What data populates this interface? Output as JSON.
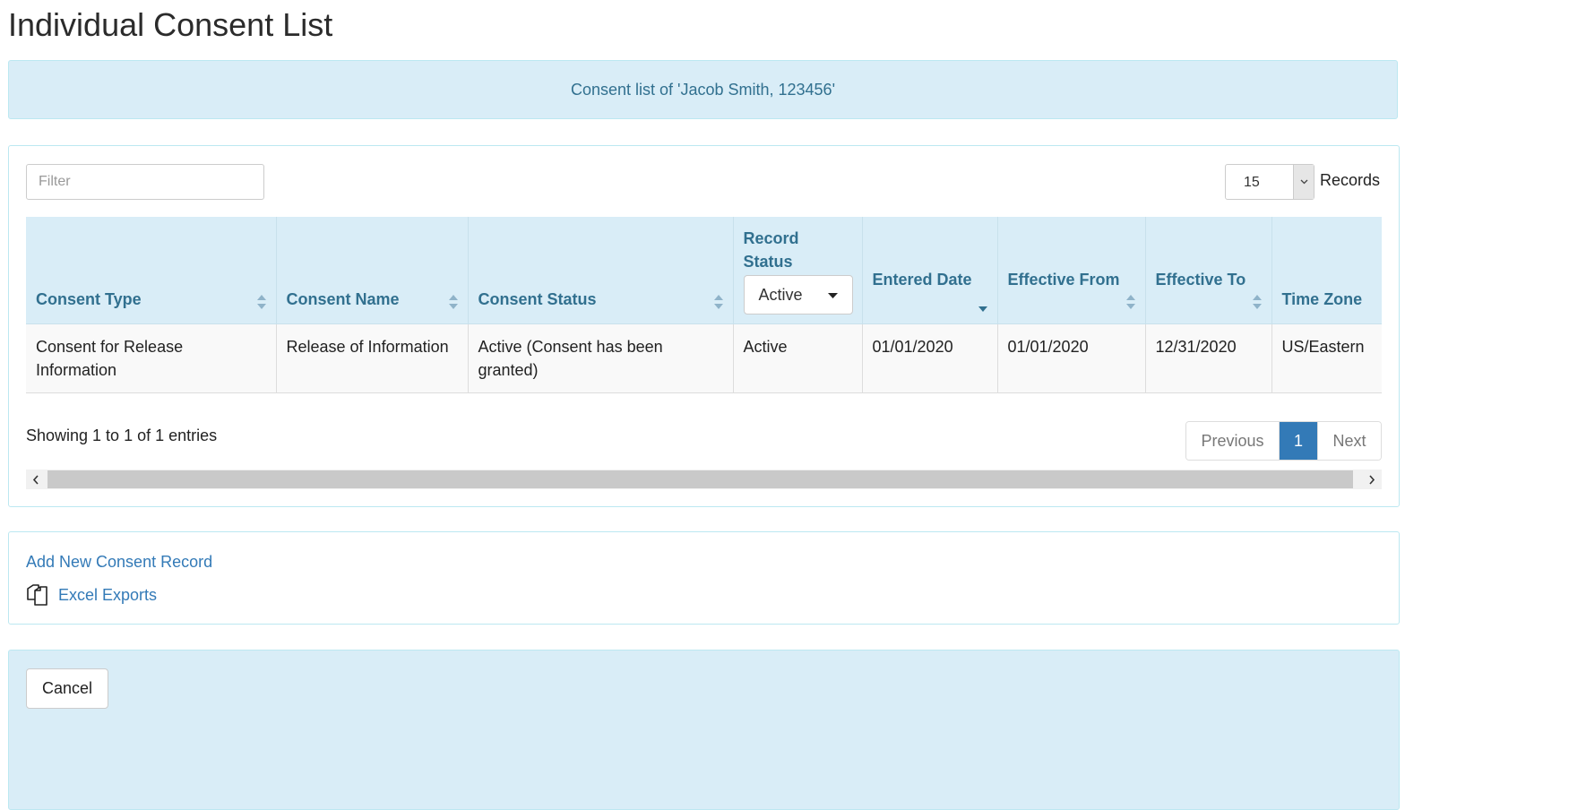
{
  "page": {
    "title": "Individual Consent List",
    "banner": "Consent list of 'Jacob Smith, 123456'"
  },
  "toolbar": {
    "filter_placeholder": "Filter",
    "records_value": "15",
    "records_label": "Records"
  },
  "table": {
    "columns": [
      {
        "label": "Consent Type",
        "sort": "both"
      },
      {
        "label": "Consent Name",
        "sort": "both"
      },
      {
        "label": "Consent Status",
        "sort": "both"
      },
      {
        "label": "Record Status",
        "filter_value": "Active"
      },
      {
        "label": "Entered Date",
        "sort": "desc"
      },
      {
        "label": "Effective From",
        "sort": "both"
      },
      {
        "label": "Effective To",
        "sort": "both"
      },
      {
        "label": "Time Zone"
      }
    ],
    "rows": [
      [
        "Consent for Release Information",
        "Release of Information",
        "Active (Consent has been granted)",
        "Active",
        "01/01/2020",
        "01/01/2020",
        "12/31/2020",
        "US/Eastern"
      ]
    ]
  },
  "pagination": {
    "info": "Showing 1 to 1 of 1 entries",
    "previous": "Previous",
    "current": "1",
    "next": "Next"
  },
  "actions": {
    "add_new": "Add New Consent Record",
    "excel_exports": "Excel Exports"
  },
  "footer": {
    "cancel": "Cancel"
  },
  "colors": {
    "header_bg": "#d9edf7",
    "header_text": "#31708f",
    "link": "#337ab7",
    "active_page": "#337ab7"
  }
}
